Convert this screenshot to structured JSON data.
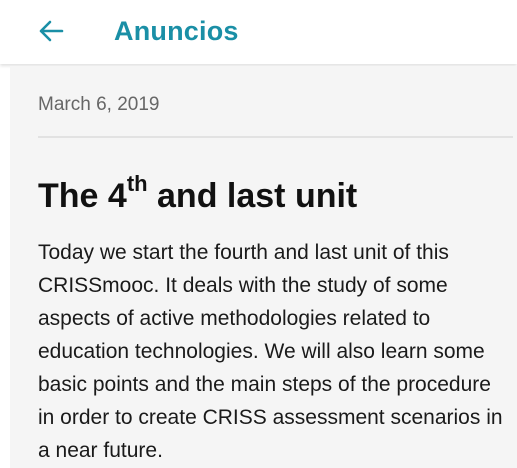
{
  "header": {
    "title": "Anuncios",
    "back_icon": "arrow-left-icon",
    "accent_color": "#1a8fa6"
  },
  "announcement": {
    "date": "March 6, 2019",
    "headline_prefix": "The 4",
    "headline_sup": "th",
    "headline_suffix": " and last unit",
    "body": "Today we start the fourth and last unit of this CRISSmooc. It deals with the study of some aspects of active methodologies related to education technologies. We will also learn some basic points and the main steps of the procedure in order to create CRISS assessment scenarios in a near future."
  }
}
